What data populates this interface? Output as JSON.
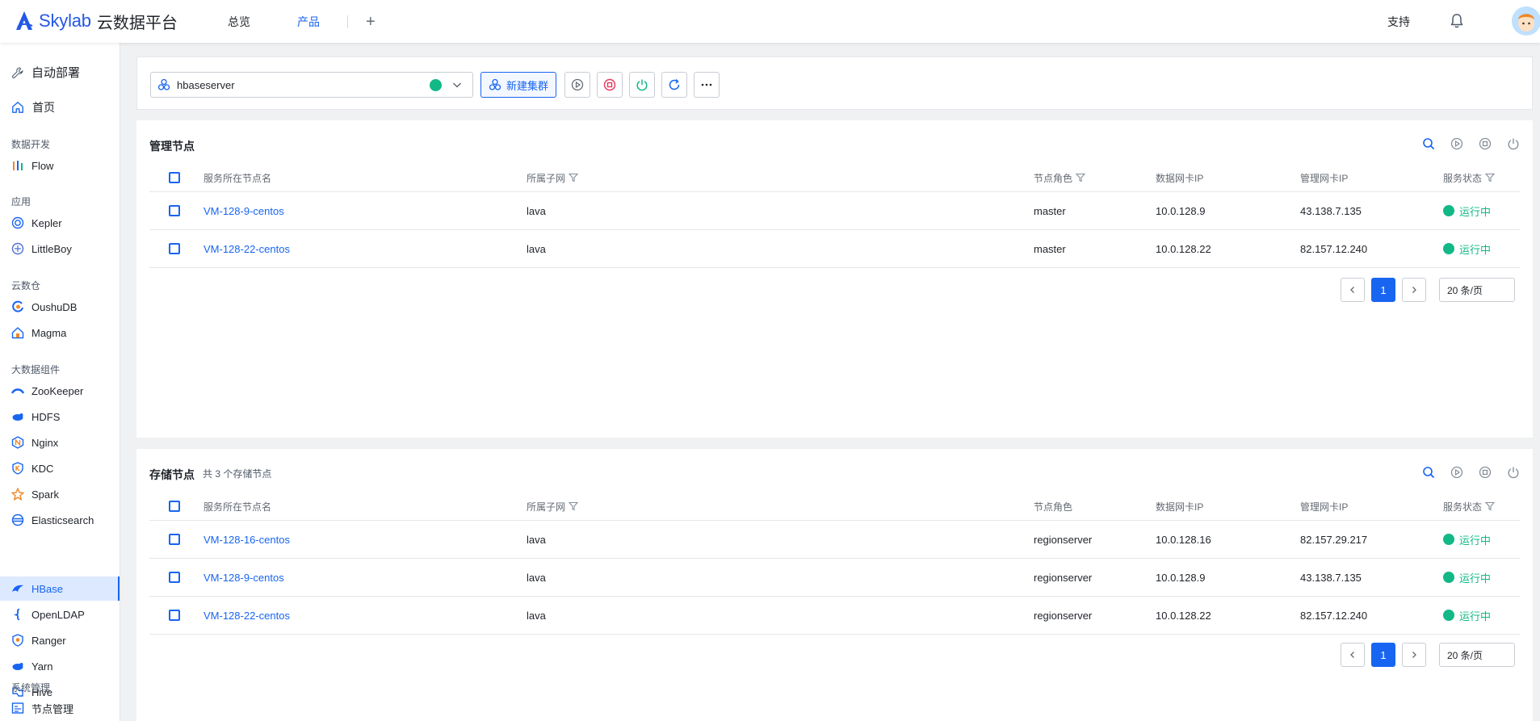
{
  "brand": {
    "logo_text": "Skylab",
    "platform_name": "云数据平台"
  },
  "topnav": {
    "items": [
      "总览",
      "产品"
    ],
    "active": "产品",
    "plus": "+"
  },
  "topright": {
    "support": "支持"
  },
  "sidebar": {
    "header": "自动部署",
    "home": "首页",
    "groups": {
      "dev": "数据开发",
      "app": "应用",
      "warehouse": "云数仓",
      "bigdata": "大数据组件",
      "system": "系统管理"
    },
    "items": {
      "flow": "Flow",
      "kepler": "Kepler",
      "littleboy": "LittleBoy",
      "oushudb": "OushuDB",
      "magma": "Magma",
      "zookeeper": "ZooKeeper",
      "hdfs": "HDFS",
      "nginx": "Nginx",
      "kdc": "KDC",
      "spark": "Spark",
      "elasticsearch": "Elasticsearch",
      "hbase": "HBase",
      "openldap": "OpenLDAP",
      "ranger": "Ranger",
      "yarn": "Yarn",
      "hive": "Hive",
      "node_mgmt": "节点管理"
    },
    "active": "HBase"
  },
  "toolbar": {
    "cluster_value": "hbaseserver",
    "new_cluster": "新建集群",
    "colors": {
      "start": "#646a73",
      "stop": "#e8365d",
      "power": "#12b886",
      "refresh": "#1865f2"
    }
  },
  "headers": {
    "node_name": "服务所在节点名",
    "subnet": "所属子网",
    "role": "节点角色",
    "data_ip": "数据网卡IP",
    "mgmt_ip": "管理网卡IP",
    "status": "服务状态"
  },
  "manage": {
    "title": "管理节点",
    "rows": [
      {
        "name": "VM-128-9-centos",
        "subnet": "lava",
        "role": "master",
        "data_ip": "10.0.128.9",
        "mgmt_ip": "43.138.7.135",
        "status": "运行中"
      },
      {
        "name": "VM-128-22-centos",
        "subnet": "lava",
        "role": "master",
        "data_ip": "10.0.128.22",
        "mgmt_ip": "82.157.12.240",
        "status": "运行中"
      }
    ],
    "pager": {
      "page": "1",
      "size": "20 条/页"
    }
  },
  "storage": {
    "title": "存储节点",
    "count_text": "共 3 个存储节点",
    "rows": [
      {
        "name": "VM-128-16-centos",
        "subnet": "lava",
        "role": "regionserver",
        "data_ip": "10.0.128.16",
        "mgmt_ip": "82.157.29.217",
        "status": "运行中"
      },
      {
        "name": "VM-128-9-centos",
        "subnet": "lava",
        "role": "regionserver",
        "data_ip": "10.0.128.9",
        "mgmt_ip": "43.138.7.135",
        "status": "运行中"
      },
      {
        "name": "VM-128-22-centos",
        "subnet": "lava",
        "role": "regionserver",
        "data_ip": "10.0.128.22",
        "mgmt_ip": "82.157.12.240",
        "status": "运行中"
      }
    ],
    "pager": {
      "page": "1",
      "size": "20 条/页"
    }
  },
  "colors": {
    "accent": "#1865f2",
    "running": "#12b886",
    "danger": "#e8365d"
  }
}
